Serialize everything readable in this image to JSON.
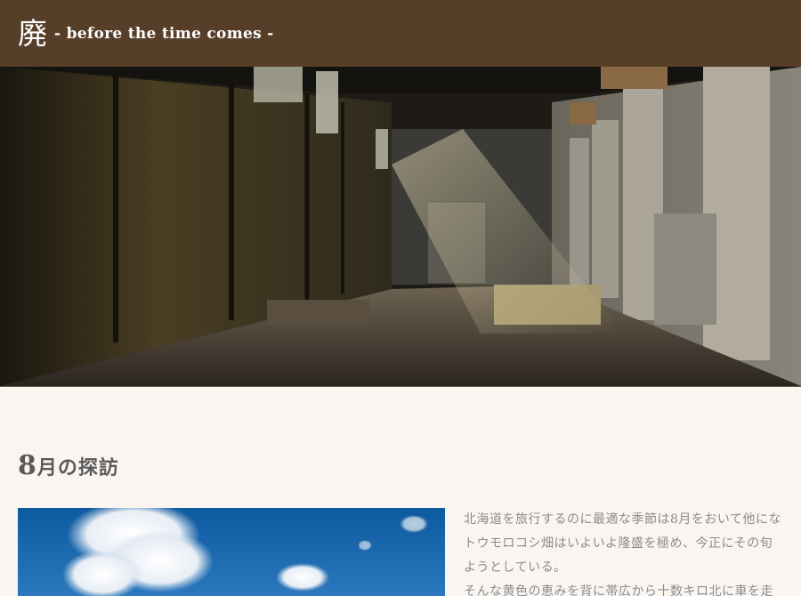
{
  "header": {
    "logo_kanji": "廃",
    "logo_subtitle": "- before the time comes -",
    "background_color": "#573e28"
  },
  "hero": {
    "image_description_icon": "abandoned-factory-photo"
  },
  "article": {
    "title_number": "8",
    "title_rest": "月の探訪",
    "paragraph_lines": [
      "北海道を旅行するのに最適な季節は8月をおいて他にな",
      "トウモロコシ畑はいよいよ隆盛を極め、今正にその旬",
      "ようとしている。",
      "そんな黄色の恵みを背に帯広から十数キロ北に車を走"
    ],
    "image_icon": "blue-sky-clouds-photo"
  }
}
